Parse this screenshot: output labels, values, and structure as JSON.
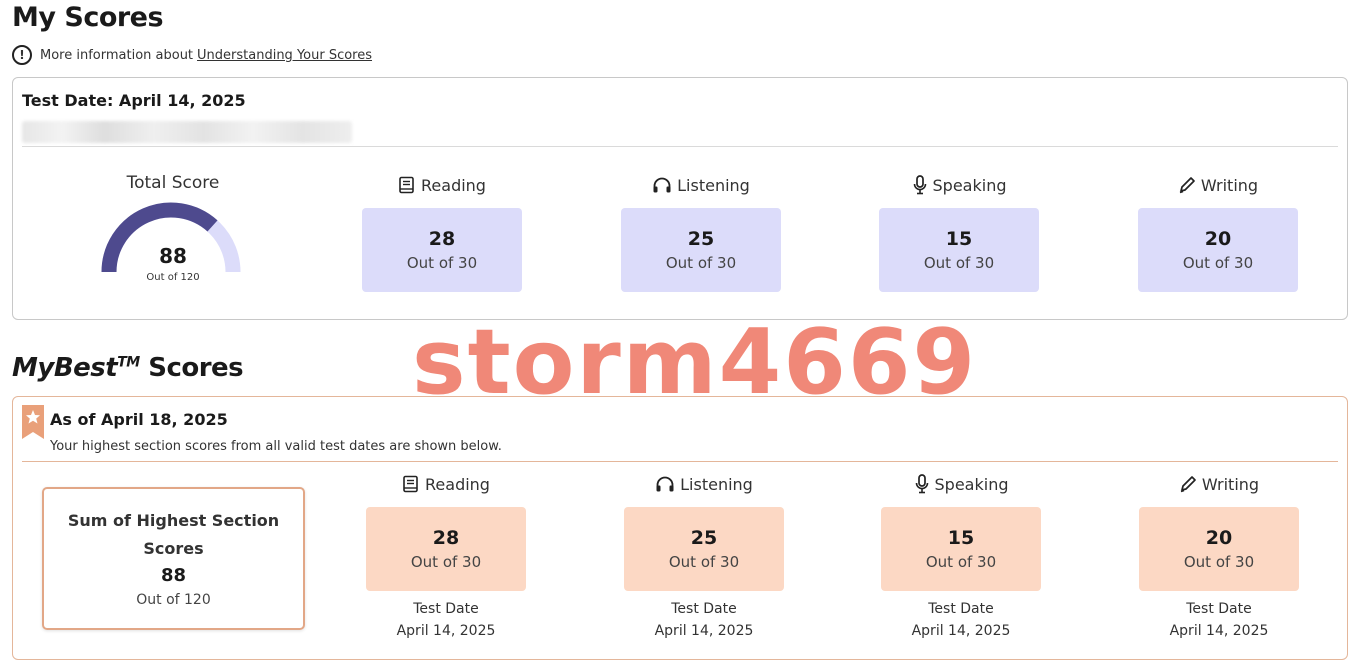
{
  "page_title": "My Scores",
  "info": {
    "text": "More information about",
    "link": "Understanding Your Scores"
  },
  "current": {
    "test_date": "Test Date: April 14, 2025",
    "total_label": "Total Score",
    "total_score": 88,
    "total_max": 120,
    "total_out": "Out of 120",
    "sections": [
      {
        "name": "Reading",
        "icon": "book-icon",
        "score": "28",
        "out": "Out of 30"
      },
      {
        "name": "Listening",
        "icon": "headphones-icon",
        "score": "25",
        "out": "Out of 30"
      },
      {
        "name": "Speaking",
        "icon": "microphone-icon",
        "score": "15",
        "out": "Out of 30"
      },
      {
        "name": "Writing",
        "icon": "pencil-icon",
        "score": "20",
        "out": "Out of 30"
      }
    ]
  },
  "watermark": "storm4669",
  "mybest": {
    "title_italic": "MyBest",
    "title_tm": "TM",
    "title_rest": " Scores",
    "as_of": "As of April 18, 2025",
    "subtitle": "Your highest section scores from all valid test dates are shown below.",
    "sum_title": "Sum of Highest Section Scores",
    "sum_score": "88",
    "sum_out": "Out of 120",
    "test_date_label": "Test Date",
    "sections": [
      {
        "name": "Reading",
        "icon": "book-icon",
        "score": "28",
        "out": "Out of 30",
        "date": "April 14, 2025"
      },
      {
        "name": "Listening",
        "icon": "headphones-icon",
        "score": "25",
        "out": "Out of 30",
        "date": "April 14, 2025"
      },
      {
        "name": "Speaking",
        "icon": "microphone-icon",
        "score": "15",
        "out": "Out of 30",
        "date": "April 14, 2025"
      },
      {
        "name": "Writing",
        "icon": "pencil-icon",
        "score": "20",
        "out": "Out of 30",
        "date": "April 14, 2025"
      }
    ]
  },
  "colors": {
    "gauge_fill": "#4e4a8e",
    "gauge_track": "#dcdcfa",
    "score_box_blue": "#dcdcfa",
    "score_box_peach": "#fcd8c4",
    "best_accent": "#e2a787",
    "watermark": "#f08878"
  }
}
